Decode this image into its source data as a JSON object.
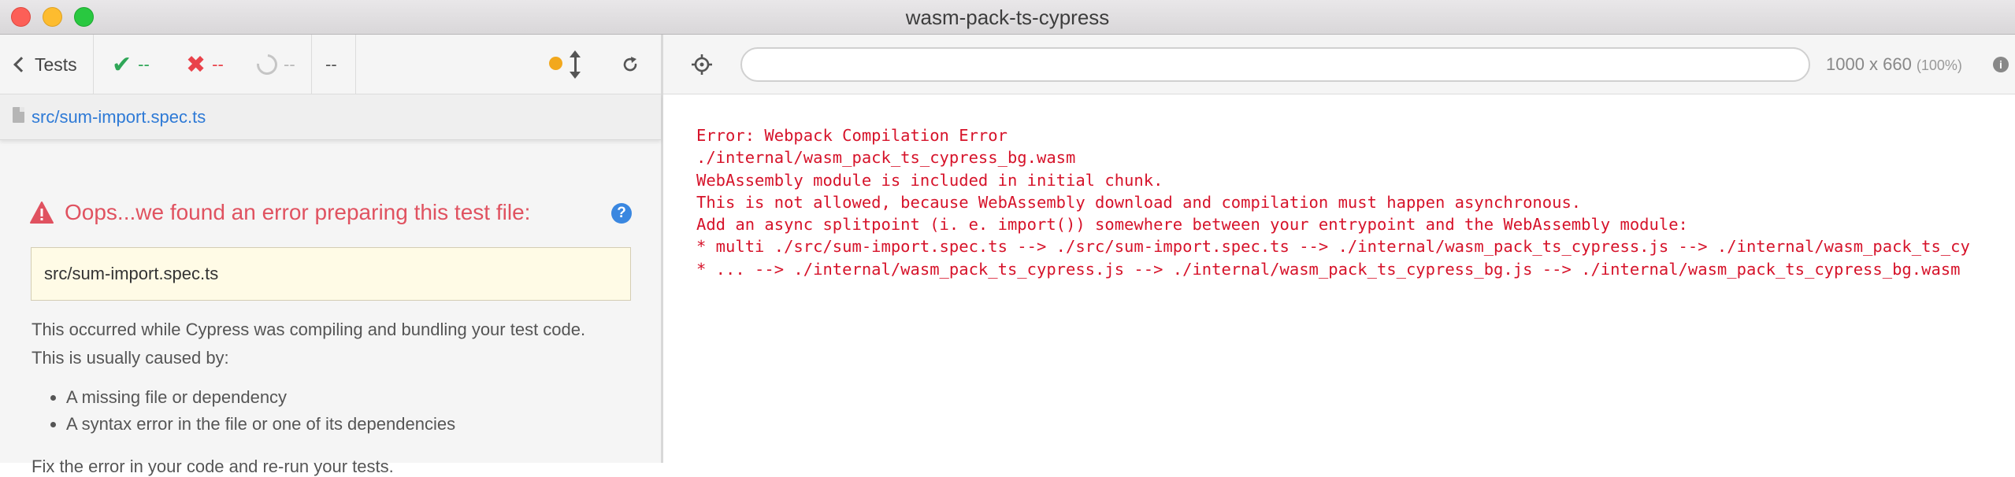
{
  "window": {
    "title": "wasm-pack-ts-cypress"
  },
  "reporter": {
    "back_label": "Tests",
    "passed": "--",
    "failed": "--",
    "pending": "--",
    "duration": "--",
    "status_color": "#f2a81d"
  },
  "spec": {
    "file": "src/sum-import.spec.ts"
  },
  "error": {
    "title": "Oops...we found an error preparing this test file:",
    "spec_file": "src/sum-import.spec.ts",
    "description_1": "This occurred while Cypress was compiling and bundling your test code.",
    "description_2": "This is usually caused by:",
    "causes": [
      "A missing file or dependency",
      "A syntax error in the file or one of its dependencies"
    ],
    "fix": "Fix the error in your code and re-run your tests."
  },
  "aut": {
    "url": "",
    "viewport_size": "1000 x 660",
    "viewport_scale": "(100%)"
  },
  "output": {
    "lines": [
      "Error: Webpack Compilation Error",
      "./internal/wasm_pack_ts_cypress_bg.wasm",
      "WebAssembly module is included in initial chunk.",
      "This is not allowed, because WebAssembly download and compilation must happen asynchronous.",
      "Add an async splitpoint (i. e. import()) somewhere between your entrypoint and the WebAssembly module:",
      "* multi ./src/sum-import.spec.ts --> ./src/sum-import.spec.ts --> ./internal/wasm_pack_ts_cypress.js --> ./internal/wasm_pack_ts_cy",
      "* ... --> ./internal/wasm_pack_ts_cypress.js --> ./internal/wasm_pack_ts_cypress_bg.js --> ./internal/wasm_pack_ts_cypress_bg.wasm"
    ]
  }
}
